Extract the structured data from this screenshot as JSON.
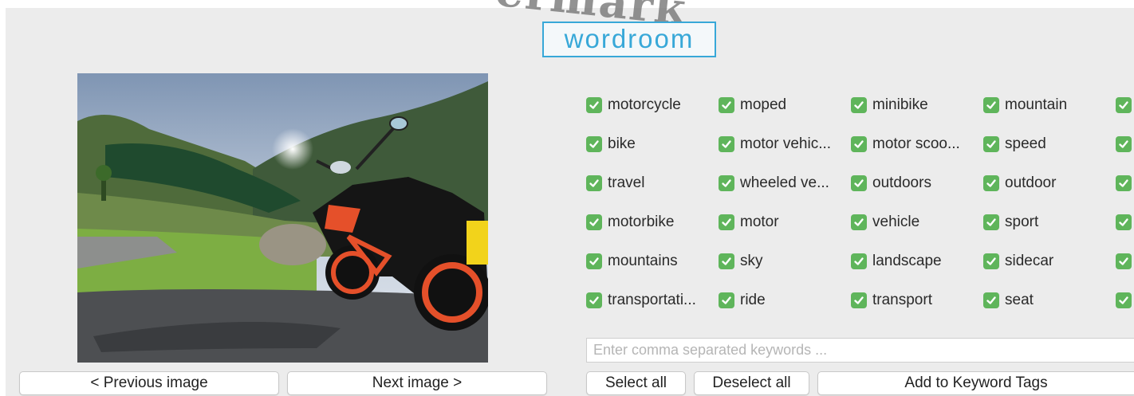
{
  "watermark": "ermark",
  "logo": {
    "text": "wordroom"
  },
  "image_nav": {
    "previous_label": "< Previous image",
    "next_label": "Next image >"
  },
  "keywords": [
    {
      "label": "motorcycle",
      "checked": true
    },
    {
      "label": "moped",
      "checked": true
    },
    {
      "label": "minibike",
      "checked": true
    },
    {
      "label": "mountain",
      "checked": true
    },
    {
      "label": "",
      "checked": true
    },
    {
      "label": "bike",
      "checked": true
    },
    {
      "label": "motor vehic...",
      "checked": true
    },
    {
      "label": "motor scoo...",
      "checked": true
    },
    {
      "label": "speed",
      "checked": true
    },
    {
      "label": "",
      "checked": true
    },
    {
      "label": "travel",
      "checked": true
    },
    {
      "label": "wheeled ve...",
      "checked": true
    },
    {
      "label": "outdoors",
      "checked": true
    },
    {
      "label": "outdoor",
      "checked": true
    },
    {
      "label": "",
      "checked": true
    },
    {
      "label": "motorbike",
      "checked": true
    },
    {
      "label": "motor",
      "checked": true
    },
    {
      "label": "vehicle",
      "checked": true
    },
    {
      "label": "sport",
      "checked": true
    },
    {
      "label": "",
      "checked": true
    },
    {
      "label": "mountains",
      "checked": true
    },
    {
      "label": "sky",
      "checked": true
    },
    {
      "label": "landscape",
      "checked": true
    },
    {
      "label": "sidecar",
      "checked": true
    },
    {
      "label": "",
      "checked": true
    },
    {
      "label": "transportati...",
      "checked": true
    },
    {
      "label": "ride",
      "checked": true
    },
    {
      "label": "transport",
      "checked": true
    },
    {
      "label": "seat",
      "checked": true
    },
    {
      "label": "",
      "checked": true
    }
  ],
  "keyword_input": {
    "placeholder": "Enter comma separated keywords ...",
    "value": ""
  },
  "actions": {
    "select_all": "Select all",
    "deselect_all": "Deselect all",
    "add_tags": "Add to Keyword Tags"
  },
  "colors": {
    "accent": "#38a8d8",
    "checkbox": "#5fb55b",
    "panel": "#ececec"
  }
}
